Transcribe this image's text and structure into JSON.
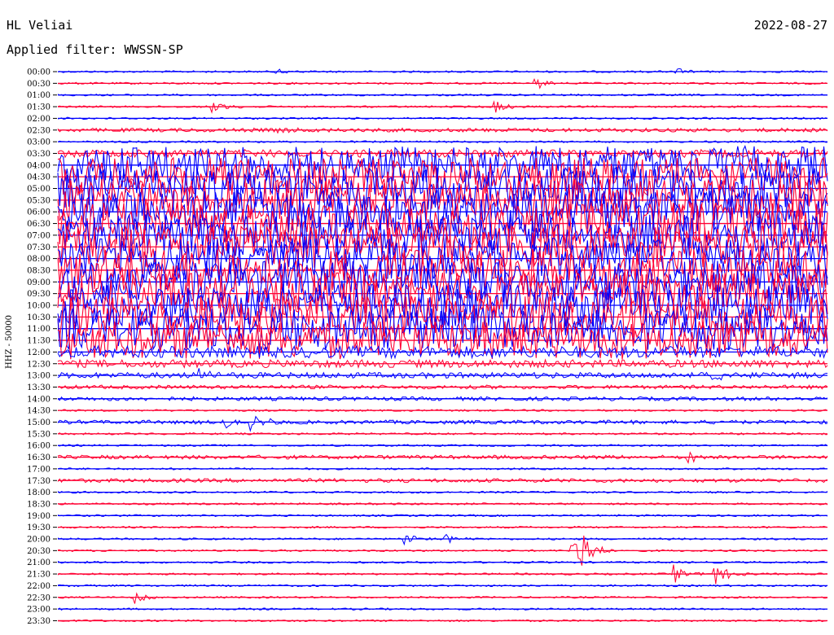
{
  "header": {
    "station": "HL Veliai",
    "date": "2022-08-27",
    "filter": "Applied filter: WWSSN-SP"
  },
  "chart_data": {
    "type": "line",
    "subtype": "helicorder",
    "ylabel": "HHZ - 50000",
    "row_labels": [
      "00:00",
      "00:30",
      "01:00",
      "01:30",
      "02:00",
      "02:30",
      "03:00",
      "03:30",
      "04:00",
      "04:30",
      "05:00",
      "05:30",
      "06:00",
      "06:30",
      "07:00",
      "07:30",
      "08:00",
      "08:30",
      "09:00",
      "09:30",
      "10:00",
      "10:30",
      "11:00",
      "11:30",
      "12:00",
      "12:30",
      "13:00",
      "13:30",
      "14:00",
      "14:30",
      "15:00",
      "15:30",
      "16:00",
      "16:30",
      "17:00",
      "17:30",
      "18:00",
      "18:30",
      "19:00",
      "19:30",
      "20:00",
      "20:30",
      "21:00",
      "21:30",
      "22:00",
      "22:30",
      "23:00",
      "23:30"
    ],
    "colors": {
      "even_rows": "#0000ff",
      "odd_rows": "#ff0033",
      "axis": "#000000",
      "background": "#ffffff"
    },
    "rows_minutes": 30,
    "row_noise_level": [
      1,
      1,
      1,
      1,
      1,
      2,
      1,
      4,
      9,
      9,
      10,
      10,
      10,
      10,
      10,
      10,
      10,
      10,
      10,
      10,
      10,
      10,
      10,
      9,
      6,
      4,
      3,
      2,
      2,
      1,
      2,
      1,
      1,
      2,
      1,
      2,
      1,
      1,
      1,
      1,
      1,
      1,
      1,
      1,
      1,
      1,
      1,
      1
    ],
    "events": [
      {
        "row": "00:00",
        "minute": 8.5,
        "amplitude": 5
      },
      {
        "row": "00:00",
        "minute": 24.0,
        "amplitude": 6
      },
      {
        "row": "00:30",
        "minute": 18.5,
        "amplitude": 12
      },
      {
        "row": "01:30",
        "minute": 6.0,
        "amplitude": 10
      },
      {
        "row": "01:30",
        "minute": 17.0,
        "amplitude": 12
      },
      {
        "row": "02:30",
        "minute": 8.5,
        "amplitude": 4
      },
      {
        "row": "13:00",
        "minute": 5.5,
        "amplitude": 10
      },
      {
        "row": "13:00",
        "minute": 25.5,
        "amplitude": 12
      },
      {
        "row": "15:00",
        "minute": 6.5,
        "amplitude": 10
      },
      {
        "row": "15:00",
        "minute": 7.5,
        "amplitude": 12
      },
      {
        "row": "16:30",
        "minute": 24.5,
        "amplitude": 9
      },
      {
        "row": "20:00",
        "minute": 13.5,
        "amplitude": 8
      },
      {
        "row": "20:00",
        "minute": 15.0,
        "amplitude": 10
      },
      {
        "row": "20:30",
        "minute": 20.0,
        "amplitude": 80
      },
      {
        "row": "21:30",
        "minute": 24.0,
        "amplitude": 12
      },
      {
        "row": "21:30",
        "minute": 25.5,
        "amplitude": 20
      },
      {
        "row": "22:30",
        "minute": 3.0,
        "amplitude": 8
      }
    ]
  }
}
